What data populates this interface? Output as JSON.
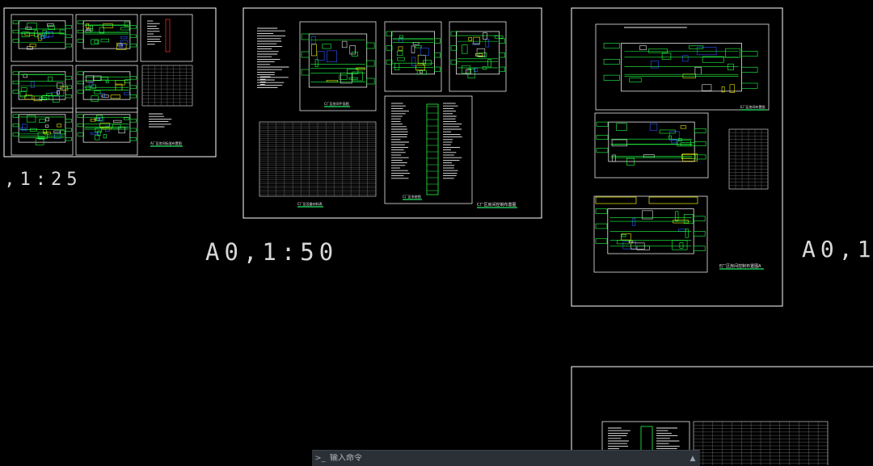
{
  "colors": {
    "background": "#000000",
    "sheet_border": "#ffffff",
    "accent_green": "#1aa84a",
    "line_green": "#22ff44",
    "line_yellow": "#f0f000",
    "line_blue": "#2f5bff",
    "line_white": "#e8e8e8",
    "line_red": "#ff3030"
  },
  "scale_labels": {
    "left": "),1:25",
    "center": "A0,1:50",
    "right": "A0,1"
  },
  "sheets": {
    "sheet_a": {
      "caption_main": "A厂区房间标准布置图"
    },
    "sheet_c": {
      "caption_schedule": "C厂区设备材料表",
      "caption_plan": "C厂区房间平面图",
      "caption_riser": "C厂区系统图",
      "caption_main": "C厂区房间控制布置图"
    },
    "sheet_e": {
      "caption_top": "E厂区房间布置图",
      "caption_main": "E厂区房间控制布置图A"
    }
  },
  "command_line": {
    "prompt_icon": "command-prompt-icon",
    "placeholder": "输入命令",
    "arrow_icon": "chevron-up-icon"
  }
}
